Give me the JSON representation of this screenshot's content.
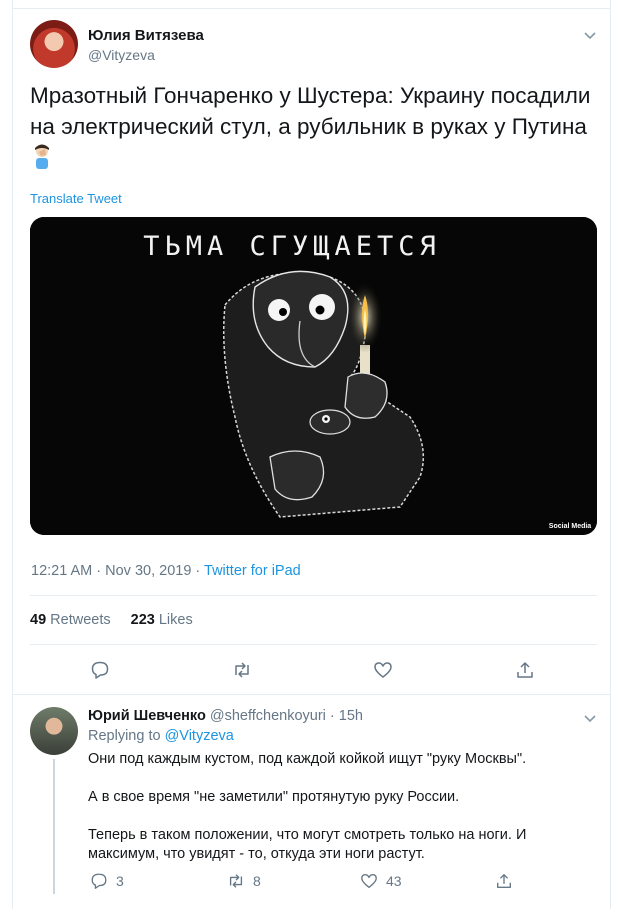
{
  "tweet": {
    "author_name": "Юлия Витязева",
    "author_handle": "@Vityzeva",
    "text": "Мразотный Гончаренко у Шустера: Украину посадили на электрический стул, а рубильник в руках у Путина",
    "emoji": "🤦‍♂️",
    "translate_label": "Translate Tweet",
    "media": {
      "caption": "ТЬМА СГУЩАЕТСЯ",
      "watermark": "Social Media"
    },
    "timestamp": "12:21 AM · Nov 30, 2019 · ",
    "source": "Twitter for iPad",
    "retweets_count": "49",
    "retweets_label": "Retweets",
    "likes_count": "223",
    "likes_label": "Likes",
    "actions": [
      "reply-icon",
      "retweet-icon",
      "like-icon",
      "share-icon"
    ]
  },
  "reply": {
    "author_name": "Юрий Шевченко",
    "author_handle": "@sheffchenkoyuri",
    "time": " · 15h",
    "replying_prefix": "Replying to ",
    "replying_to": "@Vityzeva",
    "paragraphs": [
      "Они под каждым кустом, под каждой койкой ищут \"руку Москвы\".",
      "А в свое время \"не заметили\" протянутую руку России.",
      "Теперь в таком положении, что могут смотреть только на ноги. И максимум, что увидят - то, откуда эти ноги растут."
    ],
    "reply_count": "3",
    "retweet_count": "8",
    "like_count": "43"
  },
  "colors": {
    "text": "#14171a",
    "secondary": "#657786",
    "link": "#1b95e0",
    "border": "#e6ecf0"
  }
}
